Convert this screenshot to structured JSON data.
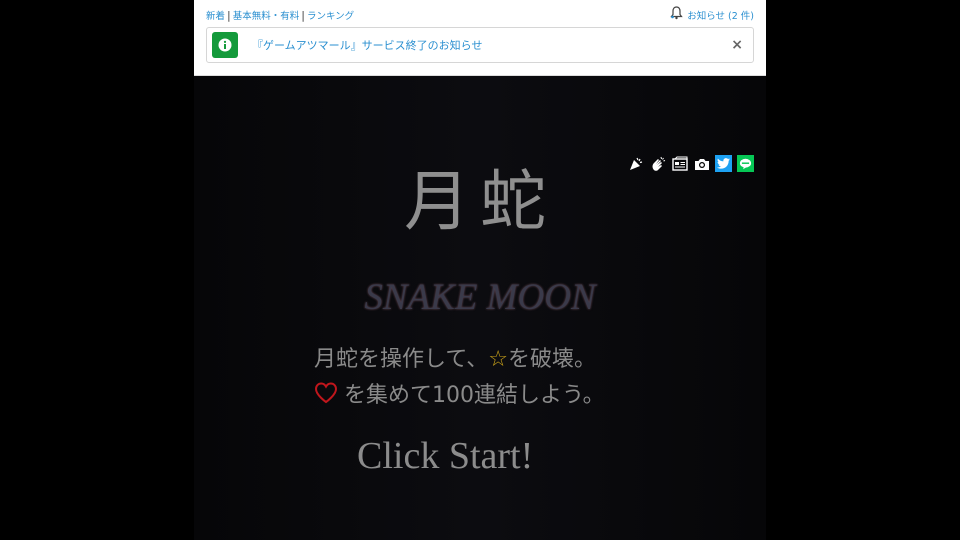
{
  "nav": {
    "links": [
      "新着",
      "基本無料・有料",
      "ランキング"
    ],
    "notifications": "お知らせ (2 件)"
  },
  "notice": {
    "text": "『ゲームアツマール』サービス終了のお知らせ",
    "close": "×"
  },
  "share_icons": [
    "party-popper-icon",
    "clap-icon",
    "news-icon",
    "camera-icon",
    "twitter-icon",
    "line-icon"
  ],
  "game": {
    "title": "月蛇",
    "subtitle": "SNAKE MOON",
    "instruction_line1_a": "月蛇を操作して、",
    "instruction_star": "☆",
    "instruction_line1_b": "を破壊。",
    "instruction_line2": "を集めて100連結しよう。",
    "start": "Click Start!"
  },
  "colors": {
    "link": "#2a8fd0",
    "info_badge": "#149a3b",
    "twitter": "#1da1f2",
    "line": "#06c755",
    "heart": "#c0161c",
    "star": "#c9a21a"
  }
}
